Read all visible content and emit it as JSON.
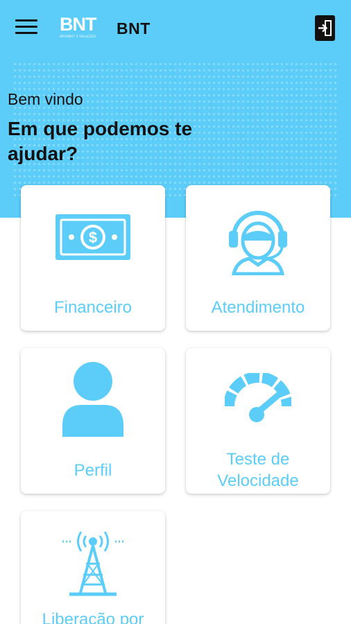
{
  "header": {
    "logo_text": "BNT",
    "logo_subtext": "INTERNET E SOLUÇÕES",
    "title": "BNT",
    "menu_icon": "hamburger-menu-icon",
    "logout_icon": "logout-icon"
  },
  "hero": {
    "welcome": "Bem vindo",
    "headline": "Em que podemos te ajudar?"
  },
  "cards": [
    {
      "label": "Financeiro",
      "icon": "money-bill-icon"
    },
    {
      "label": "Atendimento",
      "icon": "headset-support-icon"
    },
    {
      "label": "Perfil",
      "icon": "user-profile-icon"
    },
    {
      "label": "Teste de Velocidade",
      "icon": "speedometer-icon"
    },
    {
      "label": "Liberação por",
      "icon": "broadcast-tower-icon"
    }
  ],
  "colors": {
    "accent": "#5ccdf9",
    "text": "#111111",
    "card_bg": "#ffffff"
  }
}
